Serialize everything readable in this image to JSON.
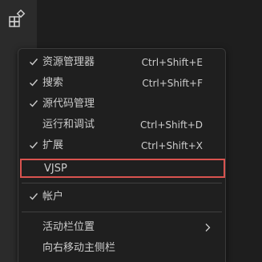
{
  "activity_bar": {
    "extensions_icon": "extensions-icon"
  },
  "menu": {
    "items": [
      {
        "label": "资源管理器",
        "shortcut": "Ctrl+Shift+E",
        "checked": true
      },
      {
        "label": "搜索",
        "shortcut": "Ctrl+Shift+F",
        "checked": true
      },
      {
        "label": "源代码管理",
        "shortcut": "",
        "checked": true
      },
      {
        "label": "运行和调试",
        "shortcut": "Ctrl+Shift+D",
        "checked": false
      },
      {
        "label": "扩展",
        "shortcut": "Ctrl+Shift+X",
        "checked": true
      },
      {
        "label": "VJSP",
        "shortcut": "",
        "checked": false,
        "highlighted": true
      }
    ],
    "accounts": {
      "label": "帐户",
      "checked": true
    },
    "activity_bar_position": {
      "label": "活动栏位置",
      "submenu": true
    },
    "move_primary_sidebar": {
      "label": "向右移动主侧栏"
    }
  },
  "colors": {
    "highlight_border": "#d9534f",
    "menu_background": "#1f1f1f",
    "text": "#cccccc"
  }
}
